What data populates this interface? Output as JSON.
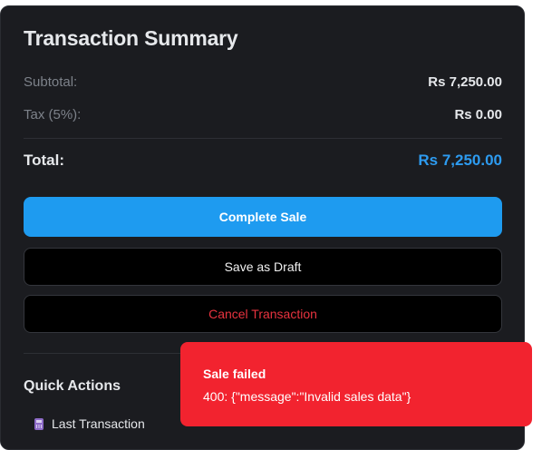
{
  "summary": {
    "title": "Transaction Summary",
    "subtotal_label": "Subtotal:",
    "subtotal_value": "Rs 7,250.00",
    "tax_label": "Tax (5%):",
    "tax_value": "Rs 0.00",
    "total_label": "Total:",
    "total_value": "Rs 7,250.00"
  },
  "actions": {
    "complete_label": "Complete Sale",
    "draft_label": "Save as Draft",
    "cancel_label": "Cancel Transaction"
  },
  "quick_actions": {
    "title": "Quick Actions",
    "items": [
      {
        "icon": "calculator-icon",
        "label": "Last Transaction"
      }
    ]
  },
  "toast": {
    "title": "Sale failed",
    "message": "400: {\"message\":\"Invalid sales data\"}"
  },
  "colors": {
    "panel_bg": "#1b1c20",
    "primary": "#1e9bf0",
    "total_accent": "#2d9bf0",
    "danger_text": "#e8333f",
    "toast_bg": "#f2232f"
  }
}
